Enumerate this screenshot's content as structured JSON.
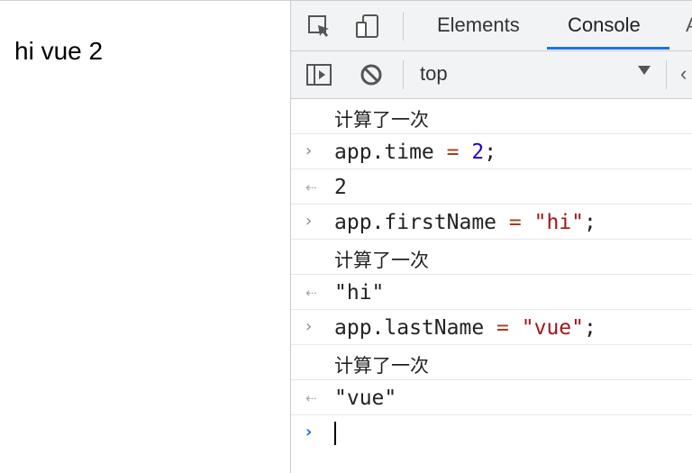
{
  "page": {
    "text": "hi vue 2"
  },
  "devtools": {
    "tabs": {
      "elements": "Elements",
      "console": "Console",
      "more": "A"
    },
    "context": {
      "label": "top"
    }
  },
  "console": {
    "log_computed": "计算了一次",
    "time": {
      "obj": "app.time",
      "op": "=",
      "val": "2",
      "semi": ";",
      "result": "2"
    },
    "first": {
      "obj": "app.firstName",
      "op": "=",
      "val": "\"hi\"",
      "semi": ";",
      "result": "\"hi\""
    },
    "last": {
      "obj": "app.lastName",
      "op": "=",
      "val": "\"vue\"",
      "semi": ";",
      "result": "\"vue\""
    }
  }
}
